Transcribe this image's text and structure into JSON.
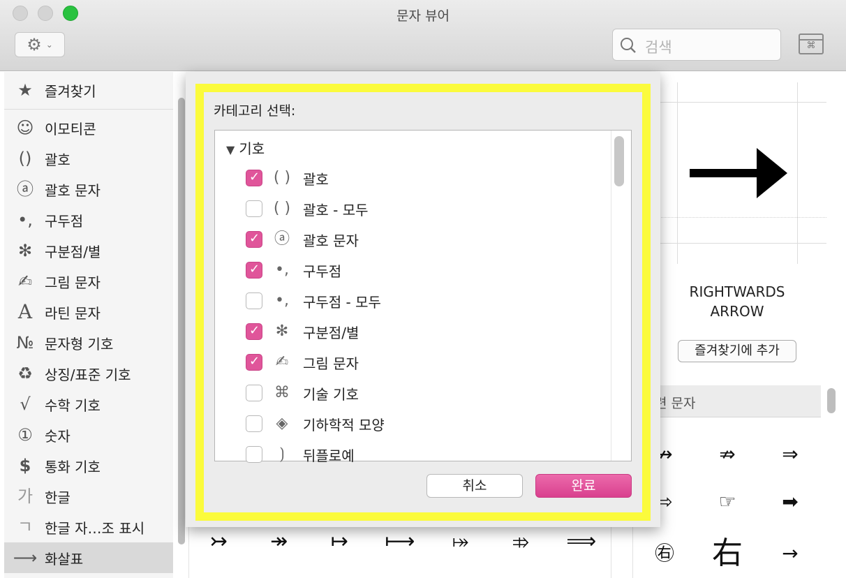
{
  "window": {
    "title": "문자 뷰어"
  },
  "toolbar": {
    "gear_icon": "⚙",
    "chevron": "⌄",
    "search_placeholder": "검색",
    "grid_glyph": "⌘"
  },
  "sidebar": {
    "items": [
      {
        "icon": "★",
        "label": "즐겨찾기"
      },
      {
        "icon": "☺",
        "label": "이모티콘"
      },
      {
        "icon": "()",
        "label": "괄호"
      },
      {
        "icon": "ⓐ",
        "label": "괄호 문자"
      },
      {
        "icon": "•,",
        "label": "구두점"
      },
      {
        "icon": "✻",
        "label": "구분점/별"
      },
      {
        "icon": "✍",
        "label": "그림 문자"
      },
      {
        "icon": "A",
        "label": "라틴 문자"
      },
      {
        "icon": "№",
        "label": "문자형 기호"
      },
      {
        "icon": "♻",
        "label": "상징/표준 기호"
      },
      {
        "icon": "√",
        "label": "수학 기호"
      },
      {
        "icon": "①",
        "label": "숫자"
      },
      {
        "icon": "$",
        "label": "통화 기호"
      },
      {
        "icon": "가",
        "label": "한글"
      },
      {
        "icon": "ㄱ",
        "label": "한글 자…조 표시"
      },
      {
        "icon": "⟶",
        "label": "화살표"
      }
    ]
  },
  "grid_row": [
    "↣",
    "↠",
    "↦",
    "⟼",
    "⤅",
    "⤃",
    "⟹"
  ],
  "preview": {
    "name_line1": "RIGHTWARDS",
    "name_line2": "ARROW",
    "fav_button": "즐겨찾기에 추가"
  },
  "related": {
    "header": "련 문자",
    "chars": [
      "↛",
      "⇏",
      "⇒",
      "⇨",
      "☞",
      "➡",
      "㊨",
      "右",
      "→"
    ]
  },
  "sheet": {
    "title": "카테고리 선택:",
    "group": "기호",
    "rows": [
      {
        "icon": "( )",
        "label": "괄호",
        "checked": true
      },
      {
        "icon": "( )",
        "label": "괄호 - 모두",
        "checked": false
      },
      {
        "icon": "ⓐ",
        "label": "괄호 문자",
        "checked": true
      },
      {
        "icon": "•,",
        "label": "구두점",
        "checked": true
      },
      {
        "icon": "•,",
        "label": "구두점 - 모두",
        "checked": false
      },
      {
        "icon": "✻",
        "label": "구분점/별",
        "checked": true
      },
      {
        "icon": "✍",
        "label": "그림 문자",
        "checked": true
      },
      {
        "icon": "⌘",
        "label": "기술 기호",
        "checked": false
      },
      {
        "icon": "◈",
        "label": "기하학적 모양",
        "checked": false
      },
      {
        "icon": "⟯",
        "label": "뒤플로예",
        "checked": false
      }
    ],
    "cancel": "취소",
    "done": "완료"
  }
}
